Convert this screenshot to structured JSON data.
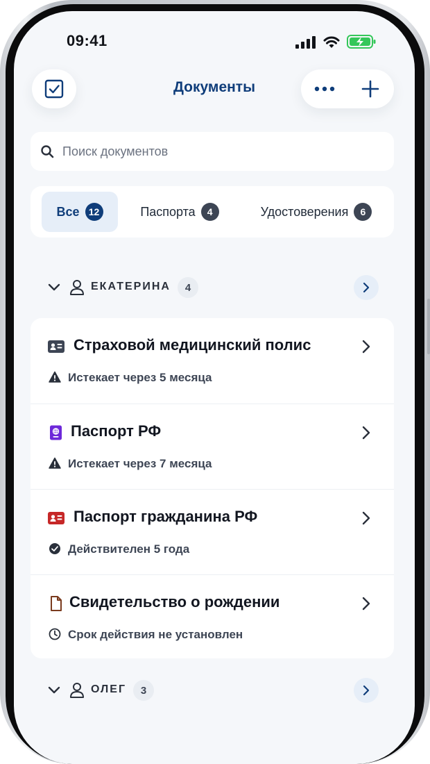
{
  "status_bar": {
    "time": "09:41"
  },
  "nav": {
    "title": "Документы"
  },
  "search": {
    "placeholder": "Поиск документов"
  },
  "tabs": [
    {
      "label": "Все",
      "count": "12",
      "active": true
    },
    {
      "label": "Паспорта",
      "count": "4",
      "active": false
    },
    {
      "label": "Удостоверения",
      "count": "6",
      "active": false
    }
  ],
  "groups": [
    {
      "name": "ЕКАТЕРИНА",
      "count": "4",
      "documents": [
        {
          "title": "Страховой медицинский полис",
          "status": "Истекает через 5 месяца",
          "icon": "id-card-icon",
          "status_icon": "warning-icon",
          "icon_color": "#3d4554"
        },
        {
          "title": "Паспорт РФ",
          "status": "Истекает через 7 месяца",
          "icon": "passport-icon",
          "status_icon": "warning-icon",
          "icon_color": "#6d28d9"
        },
        {
          "title": "Паспорт гражданина РФ",
          "status": "Действителен 5 года",
          "icon": "id-card-icon",
          "status_icon": "check-circle-icon",
          "icon_color": "#c62828"
        },
        {
          "title": "Свидетельство о рождении",
          "status": "Срок действия не установлен",
          "icon": "document-icon",
          "status_icon": "clock-icon",
          "icon_color": "#7a3b1e"
        }
      ]
    },
    {
      "name": "ОЛЕГ",
      "count": "3"
    }
  ],
  "colors": {
    "accent": "#0f3d7a",
    "background": "#f5f7fa",
    "card": "#ffffff",
    "badge": "#3d4554"
  }
}
